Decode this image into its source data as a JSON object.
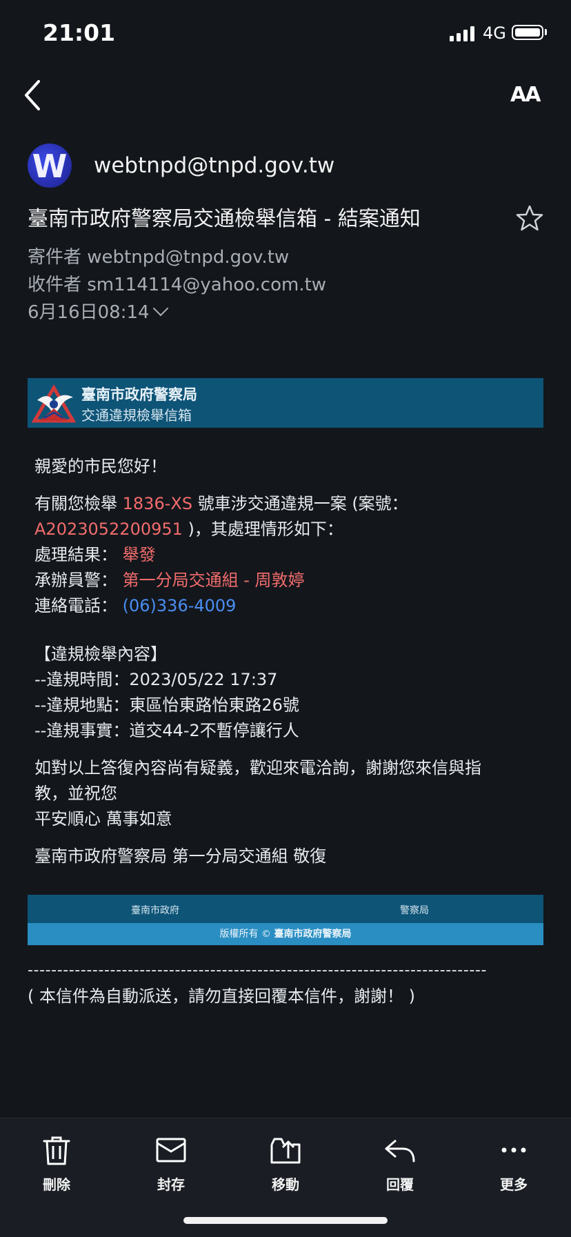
{
  "status_bar": {
    "time": "21:01",
    "network": "4G"
  },
  "nav": {
    "text_size_label": "AA"
  },
  "email": {
    "sender_display": "webtnpd@tnpd.gov.tw",
    "avatar_letter": "W",
    "subject": "臺南市政府警察局交通檢舉信箱 - 結案通知",
    "from_line": "寄件者 webtnpd@tnpd.gov.tw",
    "to_line": "收件者 sm114114@yahoo.com.tw",
    "date": "6月16日08:14"
  },
  "banner": {
    "title": "臺南市政府警察局",
    "subtitle": "交通違規檢舉信箱"
  },
  "body": {
    "greeting": "親愛的市民您好！",
    "intro_prefix": "有關您檢舉 ",
    "plate": "1836-XS",
    "intro_suffix": " 號車涉交通違規一案 (案號：",
    "case_no": "A2023052200951",
    "intro_end": " )，其處理情形如下：",
    "result_label": "處理結果：",
    "result_value": "舉發",
    "officer_label": "承辦員警：",
    "officer_value": "第一分局交通組 - 周敦婷",
    "phone_label": "連絡電話：",
    "phone_value": "(06)336-4009",
    "content_heading": "【違規檢舉內容】",
    "time_line": "--違規時間：2023/05/22 17:37",
    "place_line": "--違規地點：東區怡東路怡東路26號",
    "fact_line": "--違規事實：道交44-2不暫停讓行人",
    "closing_1": "如對以上答復內容尚有疑義，歡迎來電洽詢，謝謝您來信與指",
    "closing_2": "教，並祝您",
    "closing_3": "平安順心 萬事如意",
    "signature": "臺南市政府警察局 第一分局交通組 敬復"
  },
  "footer": {
    "link_1": "臺南市政府",
    "link_2": "警察局",
    "copyright_prefix": "版權所有 © ",
    "copyright_owner": "臺南市政府警察局"
  },
  "dashes": "------------------------------------------------------------------------------",
  "auto_note": "( 本信件為自動派送，請勿直接回覆本信件，謝謝！ )",
  "toolbar": {
    "delete": "刪除",
    "archive": "封存",
    "move": "移動",
    "reply": "回覆",
    "more": "更多"
  },
  "icons": [
    "back-icon",
    "text-size-icon",
    "star-icon",
    "trash-icon",
    "archive-icon",
    "move-icon",
    "reply-icon",
    "more-icon"
  ]
}
